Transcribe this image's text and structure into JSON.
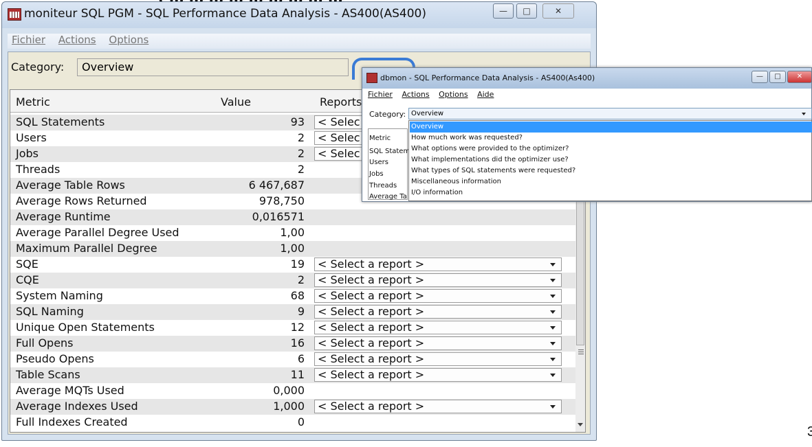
{
  "banner_cut": "( ... ... ... ... ... ... ... ... ...",
  "main_window": {
    "title": "moniteur SQL PGM - SQL Performance Data Analysis - AS400(AS400)",
    "menu": [
      "Fichier",
      "Actions",
      "Options"
    ],
    "category_label": "Category:",
    "category_value": "Overview",
    "columns": {
      "metric": "Metric",
      "value": "Value",
      "reports": "Reports"
    },
    "select_placeholder": "< Select a report >",
    "select_placeholder_cut": "< Selec",
    "rows": [
      {
        "metric": "SQL Statements",
        "value": "93"
      },
      {
        "metric": "Users",
        "value": "2"
      },
      {
        "metric": "Jobs",
        "value": "2"
      },
      {
        "metric": "Threads",
        "value": "2"
      },
      {
        "metric": "Average Table Rows",
        "value": "6 467,687"
      },
      {
        "metric": "Average Rows Returned",
        "value": "978,750"
      },
      {
        "metric": "Average Runtime",
        "value": "0,016571"
      },
      {
        "metric": "Average Parallel Degree Used",
        "value": "1,00"
      },
      {
        "metric": "Maximum Parallel Degree",
        "value": "1,00"
      },
      {
        "metric": "SQE",
        "value": "19"
      },
      {
        "metric": "CQE",
        "value": "2"
      },
      {
        "metric": "System Naming",
        "value": "68"
      },
      {
        "metric": "SQL Naming",
        "value": "9"
      },
      {
        "metric": "Unique Open Statements",
        "value": "12"
      },
      {
        "metric": "Full Opens",
        "value": "16"
      },
      {
        "metric": "Pseudo Opens",
        "value": "6"
      },
      {
        "metric": "Table Scans",
        "value": "11"
      },
      {
        "metric": "Average MQTs Used",
        "value": "0,000"
      },
      {
        "metric": "Average Indexes Used",
        "value": "1,000"
      },
      {
        "metric": "Full Indexes Created",
        "value": "0"
      }
    ]
  },
  "overlay_window": {
    "title": "dbmon - SQL Performance Data Analysis - AS400(As400)",
    "menu": [
      "Fichier",
      "Actions",
      "Options",
      "Aide"
    ],
    "category_label": "Category:",
    "category_value": "Overview",
    "options": [
      "Overview",
      "How much work was requested?",
      "What options were provided to the optimizer?",
      "What implementations did the optimizer use?",
      "What types of SQL statements were requested?",
      "Miscellaneous information",
      "I/O information"
    ],
    "behind_items": [
      "Metric",
      "SQL Statem",
      "Users",
      "Jobs",
      "Threads",
      "Average Ta"
    ]
  },
  "page_number": "3",
  "colors": {
    "accent": "#3399ff",
    "connector": "#3a7bd5"
  }
}
